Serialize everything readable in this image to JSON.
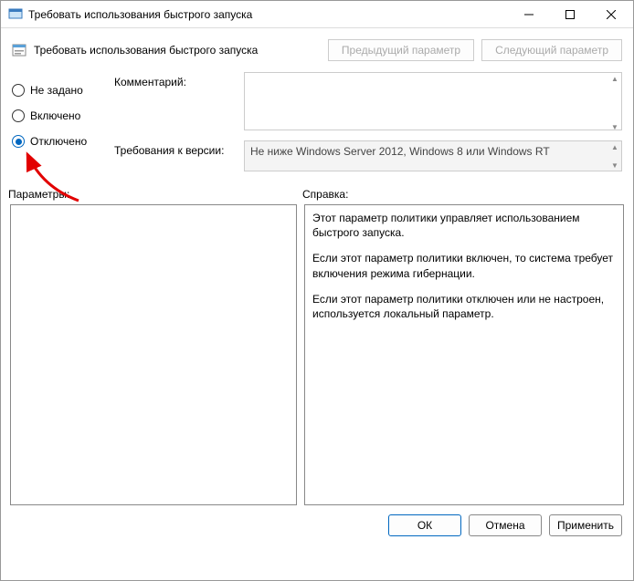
{
  "window": {
    "title": "Требовать использования быстрого запуска"
  },
  "header": {
    "policy_title": "Требовать использования быстрого запуска",
    "prev_btn": "Предыдущий параметр",
    "next_btn": "Следующий параметр"
  },
  "radios": {
    "not_configured": "Не задано",
    "enabled": "Включено",
    "disabled": "Отключено",
    "selected": "disabled"
  },
  "fields": {
    "comment_label": "Комментарий:",
    "comment_value": "",
    "supported_label": "Требования к версии:",
    "supported_value": "Не ниже Windows Server 2012, Windows 8 или Windows RT"
  },
  "sections": {
    "options_label": "Параметры:",
    "help_label": "Справка:"
  },
  "help": {
    "p1": "Этот параметр политики управляет использованием быстрого запуска.",
    "p2": "Если этот параметр политики включен, то система требует включения режима гибернации.",
    "p3": "Если этот параметр политики отключен или не настроен, используется локальный параметр."
  },
  "footer": {
    "ok": "ОК",
    "cancel": "Отмена",
    "apply": "Применить"
  }
}
